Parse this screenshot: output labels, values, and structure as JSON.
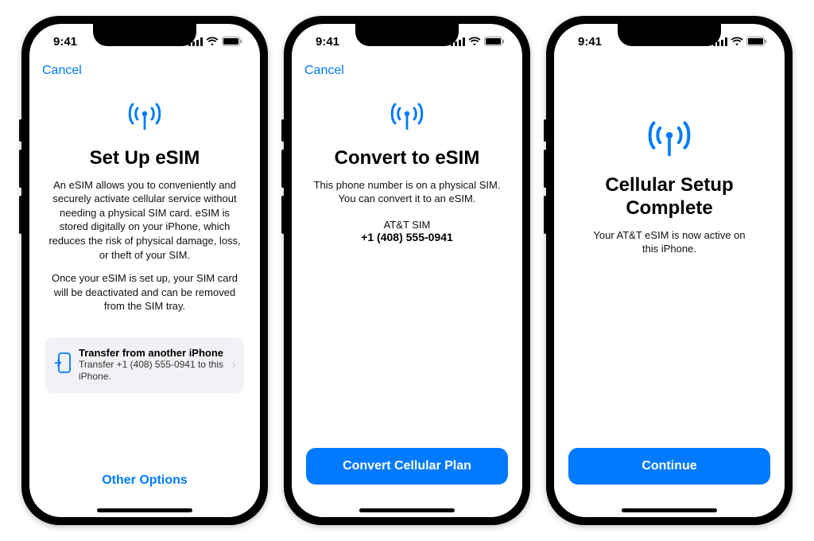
{
  "statusBar": {
    "time": "9:41"
  },
  "screen1": {
    "cancel": "Cancel",
    "title": "Set Up eSIM",
    "body1": "An eSIM allows you to conveniently and securely activate cellular service without needing a physical SIM card. eSIM is stored digitally on your iPhone, which reduces the risk of physical damage, loss, or theft of your SIM.",
    "body2": "Once your eSIM is set up, your SIM card will be deactivated and can be removed from the SIM tray.",
    "transfer": {
      "title": "Transfer from another iPhone",
      "subtitle": "Transfer +1 (408) 555-0941 to this iPhone."
    },
    "otherOptions": "Other Options"
  },
  "screen2": {
    "cancel": "Cancel",
    "title": "Convert to eSIM",
    "body": "This phone number is on a physical SIM. You can convert it to an eSIM.",
    "simLabel": "AT&T SIM",
    "phoneNumber": "+1 (408) 555-0941",
    "button": "Convert Cellular Plan"
  },
  "screen3": {
    "title": "Cellular Setup Complete",
    "body": "Your AT&T eSIM is now active on this iPhone.",
    "button": "Continue"
  }
}
